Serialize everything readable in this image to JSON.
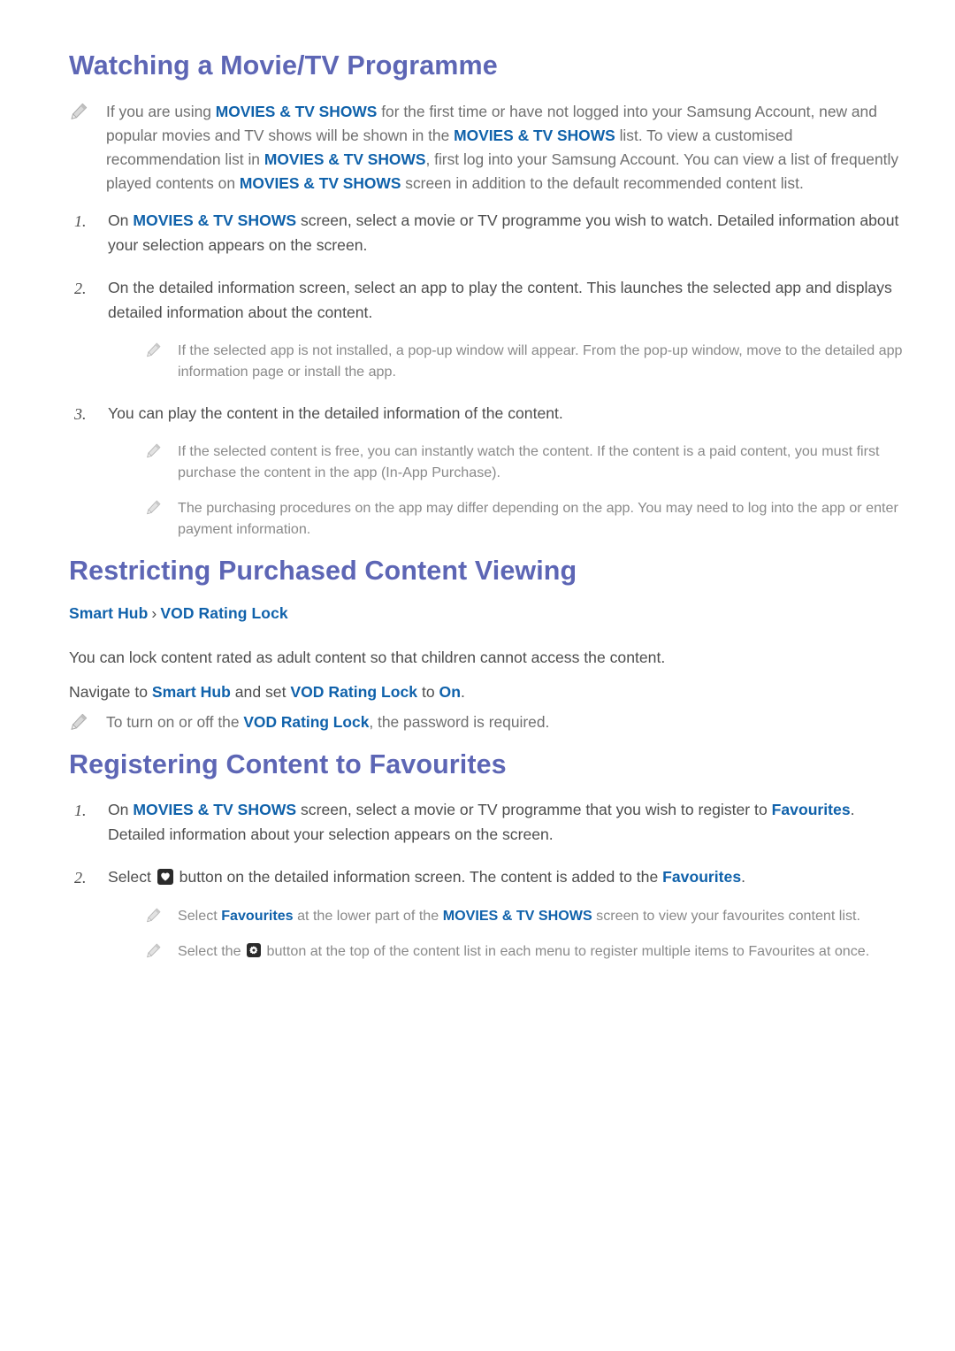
{
  "colors": {
    "heading": "#5d66b5",
    "link": "#1062ab",
    "body_text": "#4d4d4d",
    "note_text": "#6f6f6f",
    "subnote_text": "#8a8a8a",
    "button_glyph_bg": "#2b2b2b"
  },
  "sections": [
    {
      "title": "Watching a Movie/TV Programme",
      "note_intro": {
        "parts": [
          {
            "t": "If you are using ",
            "s": "plain"
          },
          {
            "t": "MOVIES & TV SHOWS",
            "s": "link"
          },
          {
            "t": " for the first time or have not logged into your Samsung Account, new and popular movies and TV shows will be shown in the ",
            "s": "plain"
          },
          {
            "t": "MOVIES & TV SHOWS",
            "s": "link"
          },
          {
            "t": " list. To view a customised recommendation list in ",
            "s": "plain"
          },
          {
            "t": "MOVIES & TV SHOWS",
            "s": "link"
          },
          {
            "t": ", first log into your Samsung Account. You can view a list of frequently played contents on ",
            "s": "plain"
          },
          {
            "t": "MOVIES & TV SHOWS",
            "s": "link"
          },
          {
            "t": " screen in addition to the default recommended content list.",
            "s": "plain"
          }
        ]
      },
      "steps": [
        {
          "num": "1.",
          "parts": [
            {
              "t": "On ",
              "s": "plain"
            },
            {
              "t": "MOVIES & TV SHOWS",
              "s": "link"
            },
            {
              "t": " screen, select a movie or TV programme you wish to watch. Detailed information about your selection appears on the screen.",
              "s": "plain"
            }
          ],
          "subnotes": []
        },
        {
          "num": "2.",
          "parts": [
            {
              "t": "On the detailed information screen, select an app to play the content. This launches the selected app and displays detailed information about the content.",
              "s": "plain"
            }
          ],
          "subnotes": [
            {
              "parts": [
                {
                  "t": "If the selected app is not installed, a pop-up window will appear. From the pop-up window, move to the detailed app information page or install the app.",
                  "s": "plain"
                }
              ]
            }
          ]
        },
        {
          "num": "3.",
          "parts": [
            {
              "t": "You can play the content in the detailed information of the content.",
              "s": "plain"
            }
          ],
          "subnotes": [
            {
              "parts": [
                {
                  "t": "If the selected content is free, you can instantly watch the content. If the content is a paid content, you must first purchase the content in the app (In-App Purchase).",
                  "s": "plain"
                }
              ]
            },
            {
              "parts": [
                {
                  "t": "The purchasing procedures on the app may differ depending on the app. You may need to log into the app or enter payment information.",
                  "s": "plain"
                }
              ]
            }
          ]
        }
      ]
    },
    {
      "title": "Restricting Purchased Content Viewing",
      "breadcrumb": {
        "first": "Smart Hub",
        "separator": "›",
        "second": "VOD Rating Lock"
      },
      "paragraphs": [
        {
          "parts": [
            {
              "t": "You can lock content rated as adult content so that children cannot access the content.",
              "s": "plain"
            }
          ]
        },
        {
          "parts": [
            {
              "t": "Navigate to ",
              "s": "plain"
            },
            {
              "t": "Smart Hub",
              "s": "link"
            },
            {
              "t": " and set ",
              "s": "plain"
            },
            {
              "t": "VOD Rating Lock",
              "s": "link"
            },
            {
              "t": " to ",
              "s": "plain"
            },
            {
              "t": "On",
              "s": "link"
            },
            {
              "t": ".",
              "s": "plain"
            }
          ]
        }
      ],
      "note": {
        "parts": [
          {
            "t": "To turn on or off the ",
            "s": "plain"
          },
          {
            "t": "VOD Rating Lock",
            "s": "link"
          },
          {
            "t": ", the password is required.",
            "s": "plain"
          }
        ]
      }
    },
    {
      "title": "Registering Content to Favourites",
      "steps": [
        {
          "num": "1.",
          "parts": [
            {
              "t": "On ",
              "s": "plain"
            },
            {
              "t": "MOVIES & TV SHOWS",
              "s": "link"
            },
            {
              "t": " screen, select a movie or TV programme that you wish to register to ",
              "s": "plain"
            },
            {
              "t": "Favourites",
              "s": "link"
            },
            {
              "t": ". Detailed information about your selection appears on the screen.",
              "s": "plain"
            }
          ],
          "subnotes": []
        },
        {
          "num": "2.",
          "parts": [
            {
              "t": "Select ",
              "s": "plain"
            },
            {
              "t": "heart-button-icon",
              "s": "icon-heart"
            },
            {
              "t": " button on the detailed information screen. The content is added to the ",
              "s": "plain"
            },
            {
              "t": "Favourites",
              "s": "link"
            },
            {
              "t": ".",
              "s": "plain"
            }
          ],
          "subnotes": [
            {
              "parts": [
                {
                  "t": "Select ",
                  "s": "plain"
                },
                {
                  "t": "Favourites",
                  "s": "link"
                },
                {
                  "t": " at the lower part of the ",
                  "s": "plain"
                },
                {
                  "t": "MOVIES & TV SHOWS",
                  "s": "link"
                },
                {
                  "t": " screen to view your favourites content list.",
                  "s": "plain"
                }
              ]
            },
            {
              "parts": [
                {
                  "t": "Select the ",
                  "s": "plain"
                },
                {
                  "t": "gear-button-icon",
                  "s": "icon-gear"
                },
                {
                  "t": " button at the top of the content list in each menu to register multiple items to Favourites at once.",
                  "s": "plain"
                }
              ]
            }
          ]
        }
      ]
    }
  ]
}
